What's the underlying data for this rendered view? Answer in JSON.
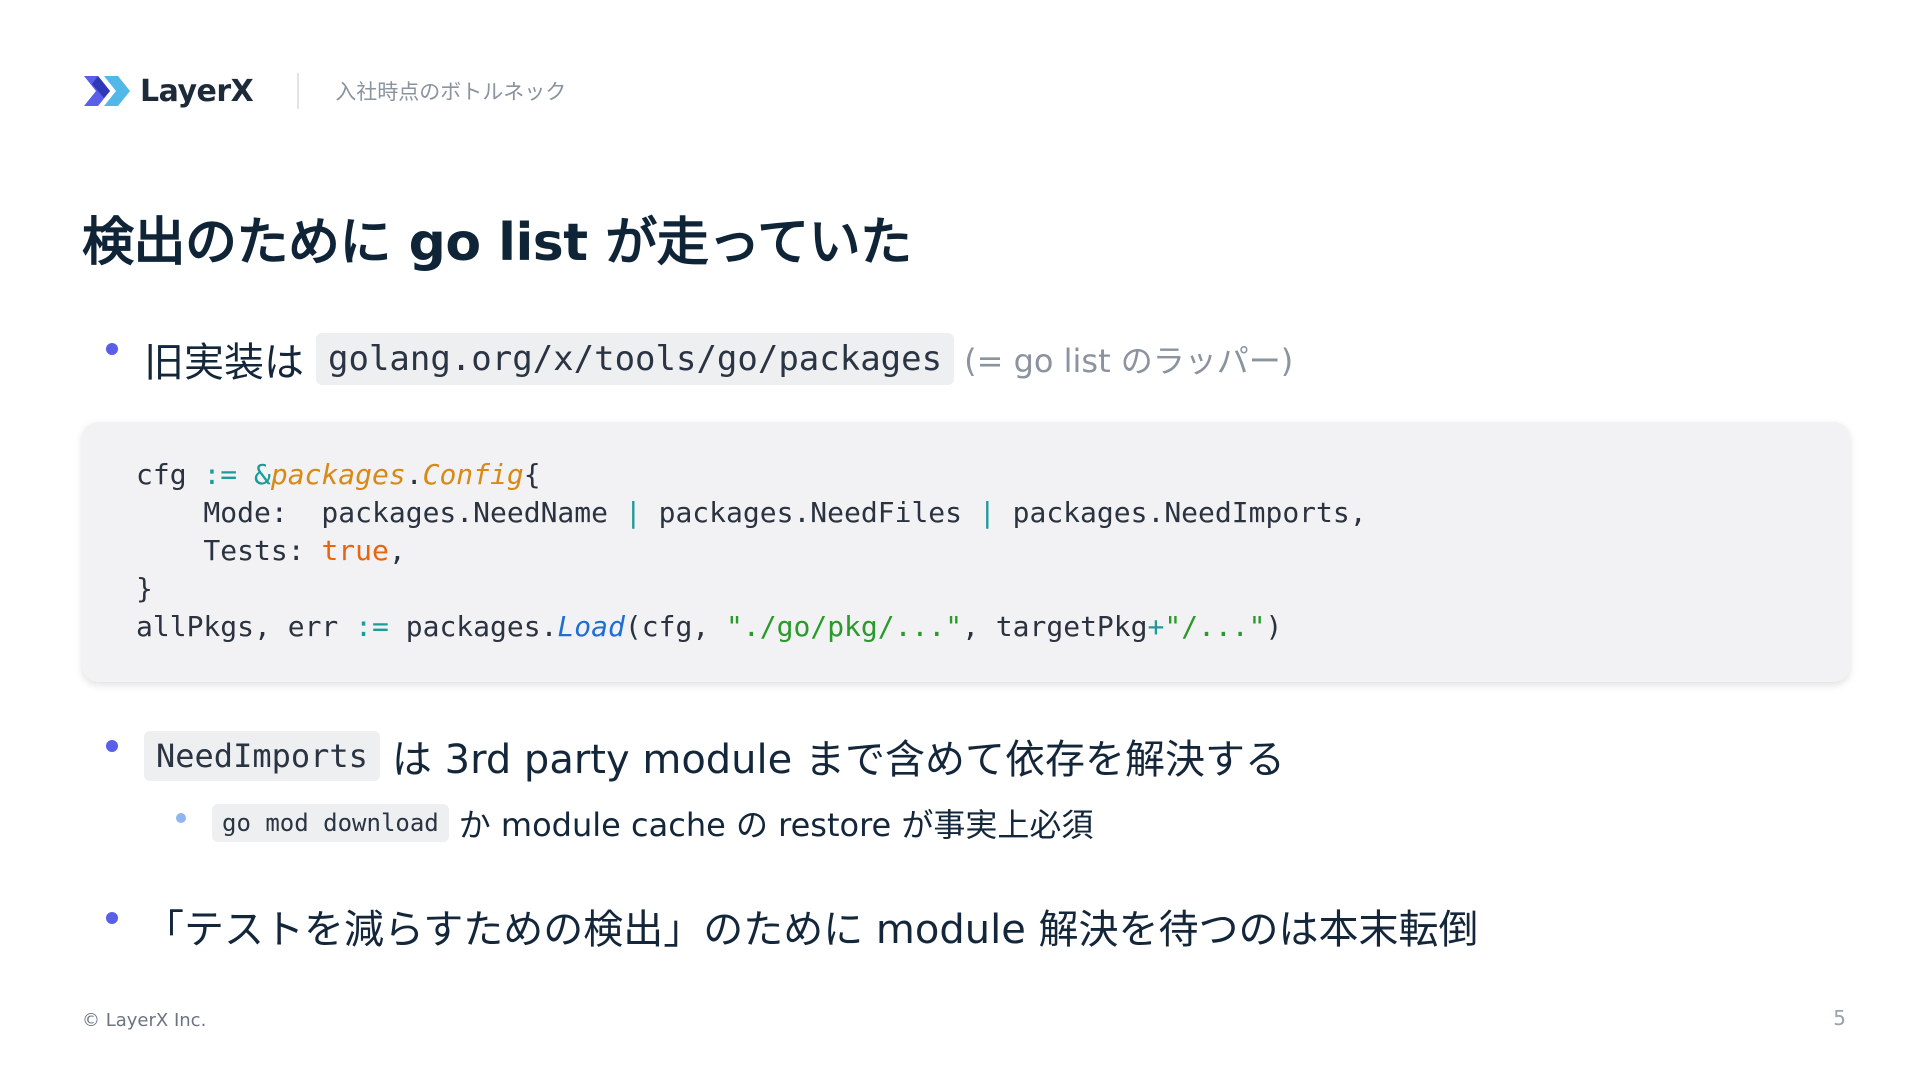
{
  "header": {
    "logo_text": "LayerX",
    "section": "入社時点のボトルネック"
  },
  "slide": {
    "title": "検出のために go list が走っていた",
    "bullet1": {
      "prefix": "旧実装は",
      "code": "golang.org/x/tools/go/packages",
      "suffix": "(= go list のラッパー)"
    },
    "code_block": {
      "lines": [
        "cfg := &packages.Config{",
        "    Mode:  packages.NeedName | packages.NeedFiles | packages.NeedImports,",
        "    Tests: true,",
        "}",
        "allPkgs, err := packages.Load(cfg, \"./go/pkg/...\", targetPkg+\"/...\")"
      ]
    },
    "bullet2": {
      "code": "NeedImports",
      "text": "は 3rd party module まで含めて依存を解決する"
    },
    "sub_bullet": {
      "code": "go mod download",
      "text": "か module cache の restore が事実上必須"
    },
    "bullet3": {
      "text": "「テストを減らすための検出」のために module 解決を待つのは本末転倒"
    }
  },
  "footer": {
    "copyright": "© LayerX Inc.",
    "page_number": "5"
  },
  "colors": {
    "bullet_dot": "#5a5ee8",
    "sub_bullet_dot": "#8fb6f0",
    "title": "#0f2436",
    "code_bg": "#f2f2f4",
    "keyword": "#e56511",
    "type": "#d88a16",
    "function": "#1f6fd0",
    "string": "#2a9a2a",
    "operator": "#1e9a9a"
  }
}
